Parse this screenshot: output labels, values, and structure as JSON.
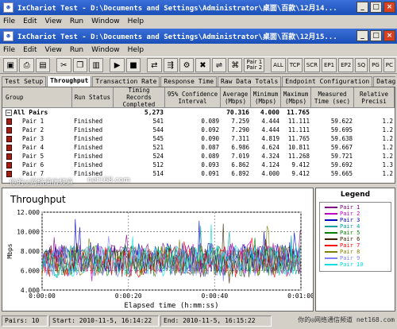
{
  "outer_window": {
    "title": "IxChariot Test - D:\\Documents and Settings\\Administrator\\桌面\\百款\\12月14..."
  },
  "outer_menu": [
    "File",
    "Edit",
    "View",
    "Run",
    "Window",
    "Help"
  ],
  "inner_window": {
    "title": "IxChariot Test - D:\\Documents and Settings\\Administrator\\桌面\\百款\\12月15..."
  },
  "inner_menu": [
    "File",
    "Edit",
    "View",
    "Run",
    "Window",
    "Help"
  ],
  "toolbar": {
    "pair_label": "Pair 1\nPair 2",
    "protocol_buttons": [
      "ALL",
      "TCP",
      "SCR",
      "EP1",
      "EP2",
      "SQ",
      "PG",
      "PC"
    ]
  },
  "tabs": [
    "Test Setup",
    "Throughput",
    "Transaction Rate",
    "Response Time",
    "Raw Data Totals",
    "Endpoint Configuration",
    "Datagram"
  ],
  "active_tab": "Throughput",
  "table": {
    "headers": [
      "Group",
      "Run Status",
      "Timing Records Completed",
      "95% Confidence Interval",
      "Average (Mbps)",
      "Minimum (Mbps)",
      "Maximum (Mbps)",
      "Measured Time (sec)",
      "Relative Precisi"
    ],
    "summary": {
      "group": "All Pairs",
      "records": "5,273",
      "average": "70.316",
      "minimum": "4.000",
      "maximum": "11.765"
    },
    "rows": [
      {
        "group": "Pair 1",
        "status": "Finished",
        "records": "541",
        "ci": "0.089",
        "avg": "7.259",
        "min": "4.444",
        "max": "11.111",
        "time": "59.622",
        "prec": "1.2"
      },
      {
        "group": "Pair 2",
        "status": "Finished",
        "records": "544",
        "ci": "0.092",
        "avg": "7.290",
        "min": "4.444",
        "max": "11.111",
        "time": "59.695",
        "prec": "1.2"
      },
      {
        "group": "Pair 3",
        "status": "Finished",
        "records": "545",
        "ci": "0.090",
        "avg": "7.311",
        "min": "4.819",
        "max": "11.765",
        "time": "59.638",
        "prec": "1.2"
      },
      {
        "group": "Pair 4",
        "status": "Finished",
        "records": "521",
        "ci": "0.087",
        "avg": "6.986",
        "min": "4.624",
        "max": "10.811",
        "time": "59.667",
        "prec": "1.2"
      },
      {
        "group": "Pair 5",
        "status": "Finished",
        "records": "524",
        "ci": "0.089",
        "avg": "7.019",
        "min": "4.324",
        "max": "11.268",
        "time": "59.721",
        "prec": "1.2"
      },
      {
        "group": "Pair 6",
        "status": "Finished",
        "records": "512",
        "ci": "0.093",
        "avg": "6.862",
        "min": "4.124",
        "max": "9.412",
        "time": "59.692",
        "prec": "1.3"
      },
      {
        "group": "Pair 7",
        "status": "Finished",
        "records": "514",
        "ci": "0.091",
        "avg": "6.892",
        "min": "4.000",
        "max": "9.412",
        "time": "59.665",
        "prec": "1.2"
      }
    ]
  },
  "chart_data": {
    "type": "line",
    "title": "Throughput",
    "xlabel": "Elapsed time (h:mm:ss)",
    "ylabel": "Mbps",
    "x_ticks": [
      "0:00:00",
      "0:00:20",
      "0:00:40",
      "0:01:00"
    ],
    "xlim_seconds": [
      0,
      60
    ],
    "y_ticks": [
      "12.000",
      "10.000",
      "8.000",
      "6.000",
      "4.000"
    ],
    "ylim": [
      4,
      12
    ],
    "series": [
      {
        "name": "Pair 1",
        "color": "#800080",
        "mean": 7.259
      },
      {
        "name": "Pair 2",
        "color": "#c000c0",
        "mean": 7.29
      },
      {
        "name": "Pair 3",
        "color": "#0000c0",
        "mean": 7.311
      },
      {
        "name": "Pair 4",
        "color": "#00a0a0",
        "mean": 6.986
      },
      {
        "name": "Pair 5",
        "color": "#008000",
        "mean": 7.019
      },
      {
        "name": "Pair 6",
        "color": "#402000",
        "mean": 6.862
      },
      {
        "name": "Pair 7",
        "color": "#ff0000",
        "mean": 6.892
      },
      {
        "name": "Pair 8",
        "color": "#808000",
        "mean": 7.0
      },
      {
        "name": "Pair 9",
        "color": "#8080ff",
        "mean": 7.0
      },
      {
        "name": "Pair 10",
        "color": "#00e0e0",
        "mean": 7.0
      }
    ]
  },
  "legend": {
    "title": "Legend"
  },
  "status": {
    "pairs": "Pairs: 10",
    "start": "Start: 2010-11-5, 16:14:22",
    "end": "End: 2010-11-5, 16:15:22"
  },
  "watermarks": [
    "你的◎网络通信频道",
    "net168.com",
    "你的◎网络通信频道 net168.com"
  ]
}
